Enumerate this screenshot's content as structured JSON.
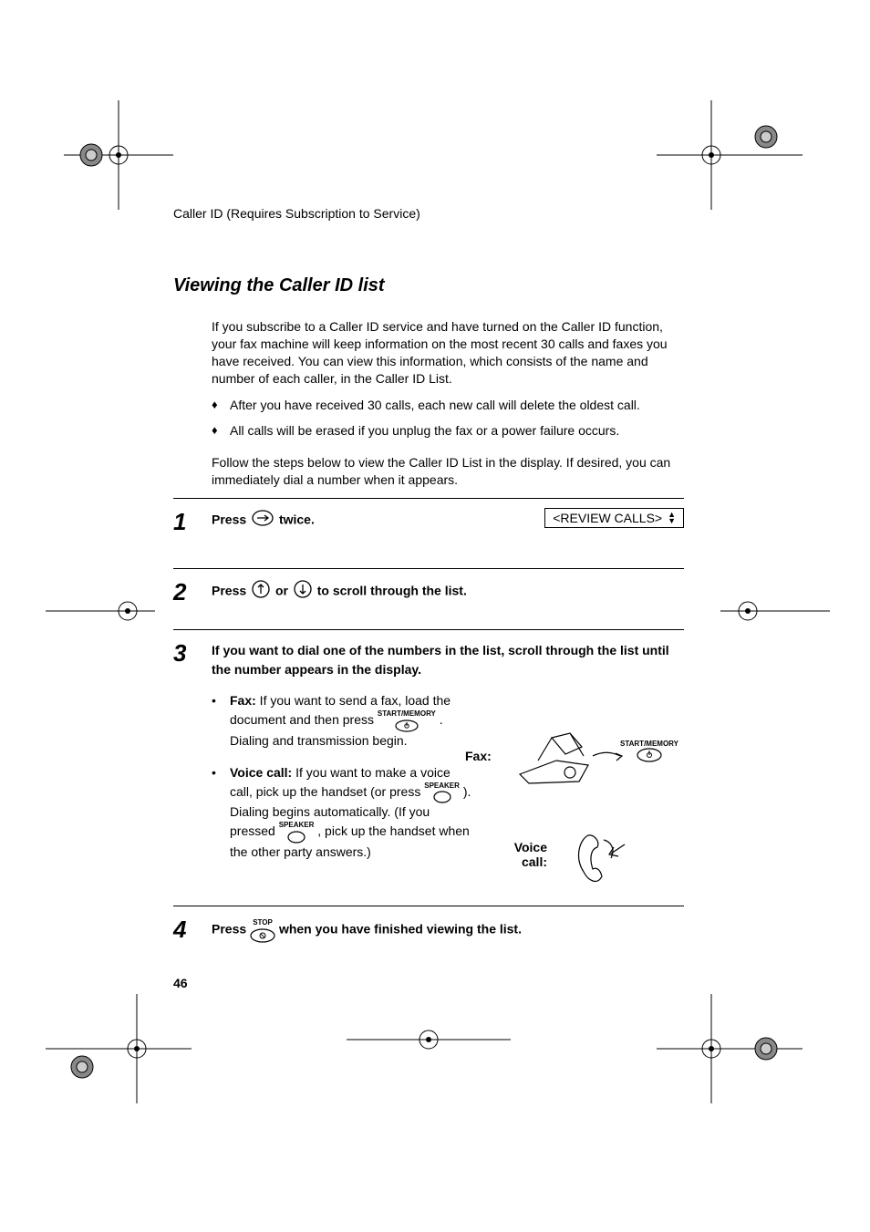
{
  "header": "Caller ID (Requires Subscription to Service)",
  "title": "Viewing the Caller ID list",
  "intro": "If you subscribe to a Caller ID service and have turned on the Caller ID function, your fax machine will keep information on the most recent 30 calls and faxes you have received. You can view this information, which consists of the name and number of each caller, in the Caller ID List.",
  "bullets": [
    "After you have received 30 calls, each new call will delete the oldest call.",
    "All calls will be erased if you unplug the fax or a power failure occurs."
  ],
  "follow": "Follow the steps below to view the Caller ID List in the display. If desired, you can immediately dial a number when it appears.",
  "steps": {
    "s1": {
      "num": "1",
      "a": "Press ",
      "b": " twice."
    },
    "display": "<REVIEW CALLS>",
    "s2": {
      "num": "2",
      "a": "Press ",
      "b": " or ",
      "c": "  to  scroll through the list."
    },
    "s3": {
      "num": "3",
      "lead": "If you want to dial one of the numbers in the list, scroll through the list until the number appears in the display.",
      "fax_a": "Fax:",
      "fax_b": " If you want to send a fax, load the document and then press ",
      "fax_c": ". Dialing and transmission begin.",
      "voice_a": "Voice call:",
      "voice_b": " If you want to make a voice call, pick up the handset (or press ",
      "voice_c": "). Dialing begins automatically. (If you pressed ",
      "voice_d": ", pick up the handset when the other party answers.)",
      "fax_label": "Fax:",
      "voice_label": "Voice call:"
    },
    "s4": {
      "num": "4",
      "a": "Press  ",
      "b": "  when you have finished viewing the list."
    }
  },
  "keys": {
    "start_memory": "START/MEMORY",
    "speaker": "SPEAKER",
    "stop": "STOP"
  },
  "page_number": "46"
}
